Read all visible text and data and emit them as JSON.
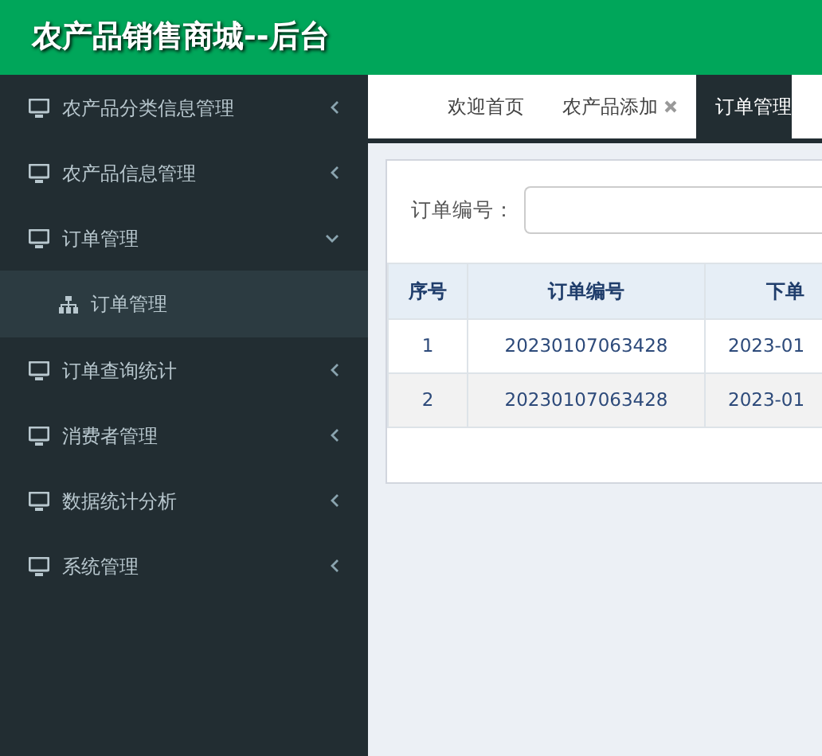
{
  "header": {
    "title": "农产品销售商城--后台"
  },
  "sidebar": {
    "items": [
      {
        "label": "农产品分类信息管理",
        "expanded": false
      },
      {
        "label": "农产品信息管理",
        "expanded": false
      },
      {
        "label": "订单管理",
        "expanded": true,
        "children": [
          {
            "label": "订单管理",
            "selected": true
          }
        ]
      },
      {
        "label": "订单查询统计",
        "expanded": false
      },
      {
        "label": "消费者管理",
        "expanded": false
      },
      {
        "label": "数据统计分析",
        "expanded": false
      },
      {
        "label": "系统管理",
        "expanded": false
      }
    ]
  },
  "tabs": [
    {
      "label": "欢迎首页",
      "selected": false,
      "closable": false
    },
    {
      "label": "农产品添加",
      "selected": false,
      "closable": true
    },
    {
      "label": "订单管理",
      "selected": true,
      "closable": false
    }
  ],
  "search": {
    "label": "订单编号："
  },
  "table": {
    "columns": [
      "序号",
      "订单编号",
      "下单"
    ],
    "rows": [
      [
        "1",
        "20230107063428",
        "2023-01"
      ],
      [
        "2",
        "20230107063428",
        "2023-01"
      ]
    ]
  }
}
